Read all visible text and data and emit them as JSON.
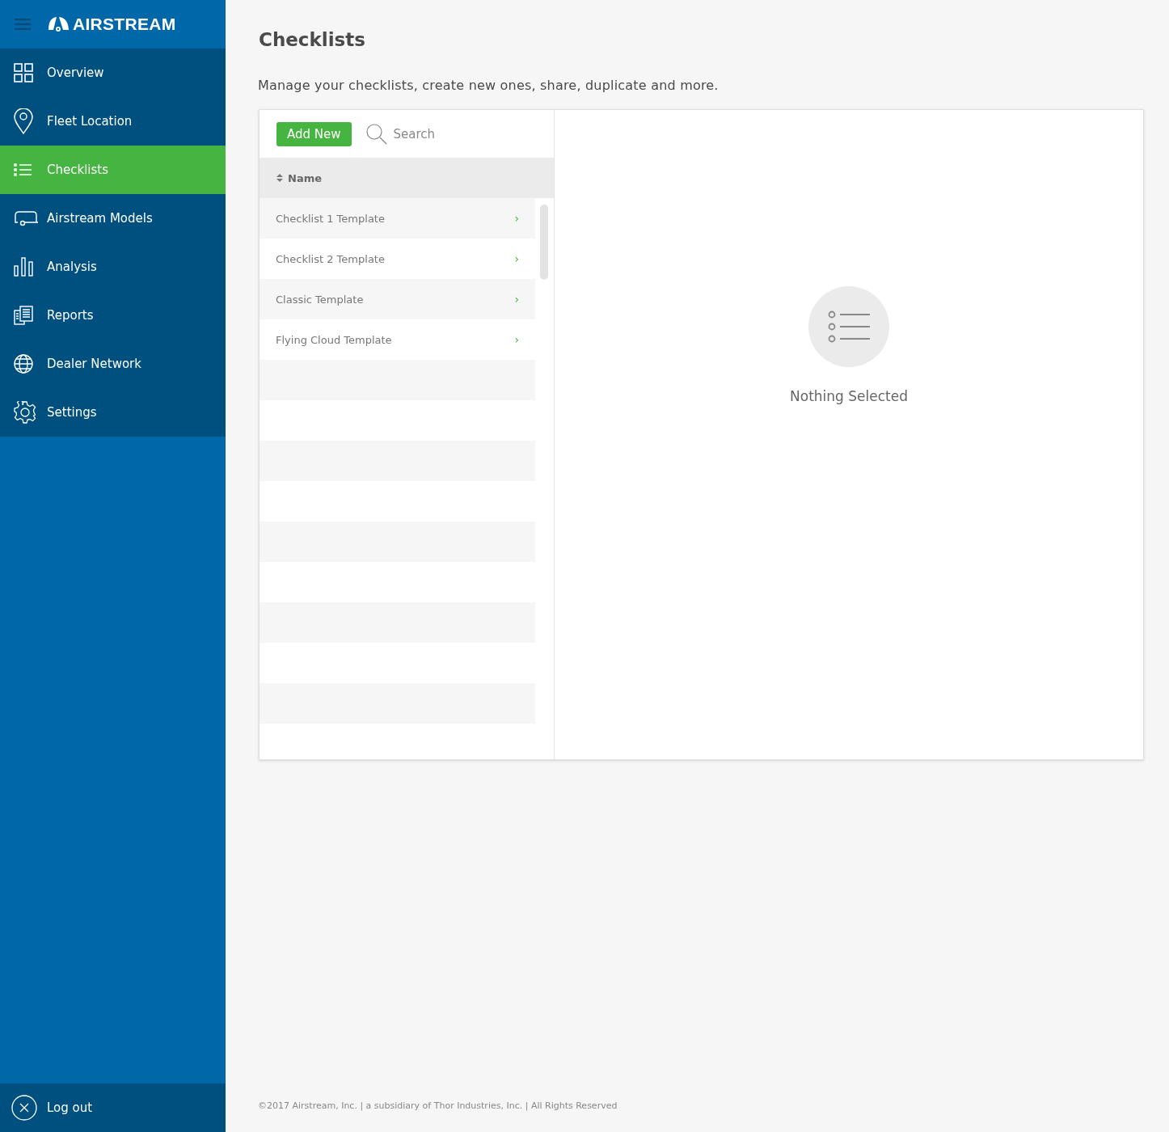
{
  "brand": {
    "name": "AIRSTREAM"
  },
  "sidebar": {
    "items": [
      {
        "label": "Overview",
        "kind": "grid",
        "selected": false
      },
      {
        "label": "Fleet Location",
        "kind": "pin",
        "selected": false
      },
      {
        "label": "Checklists",
        "kind": "list",
        "selected": true
      },
      {
        "label": "Airstream Models",
        "kind": "trailer",
        "selected": false
      },
      {
        "label": "Analysis",
        "kind": "bars",
        "selected": false
      },
      {
        "label": "Reports",
        "kind": "docs",
        "selected": false
      },
      {
        "label": "Dealer Network",
        "kind": "globe",
        "selected": false
      },
      {
        "label": "Settings",
        "kind": "gear",
        "selected": false
      }
    ],
    "logout": {
      "label": "Log out"
    }
  },
  "page": {
    "title": "Checklists",
    "description": "Manage your checklists, create new ones, share, duplicate and more."
  },
  "toolbar": {
    "add_button": "Add New",
    "search": {
      "placeholder": "Search"
    }
  },
  "table": {
    "columns": [
      "Name"
    ],
    "rows": [
      {
        "name": "Checklist 1 Template",
        "chevron": "›"
      },
      {
        "name": "Checklist 2 Template",
        "chevron": "›"
      },
      {
        "name": "Classic Template",
        "chevron": "›"
      },
      {
        "name": "Flying Cloud Template",
        "chevron": "›"
      }
    ]
  },
  "detail": {
    "empty_text": "Nothing Selected"
  },
  "footer": {
    "text": "©2017 Airstream, Inc. | a subsidiary of Thor Industries, Inc. | All Rights Reserved"
  }
}
